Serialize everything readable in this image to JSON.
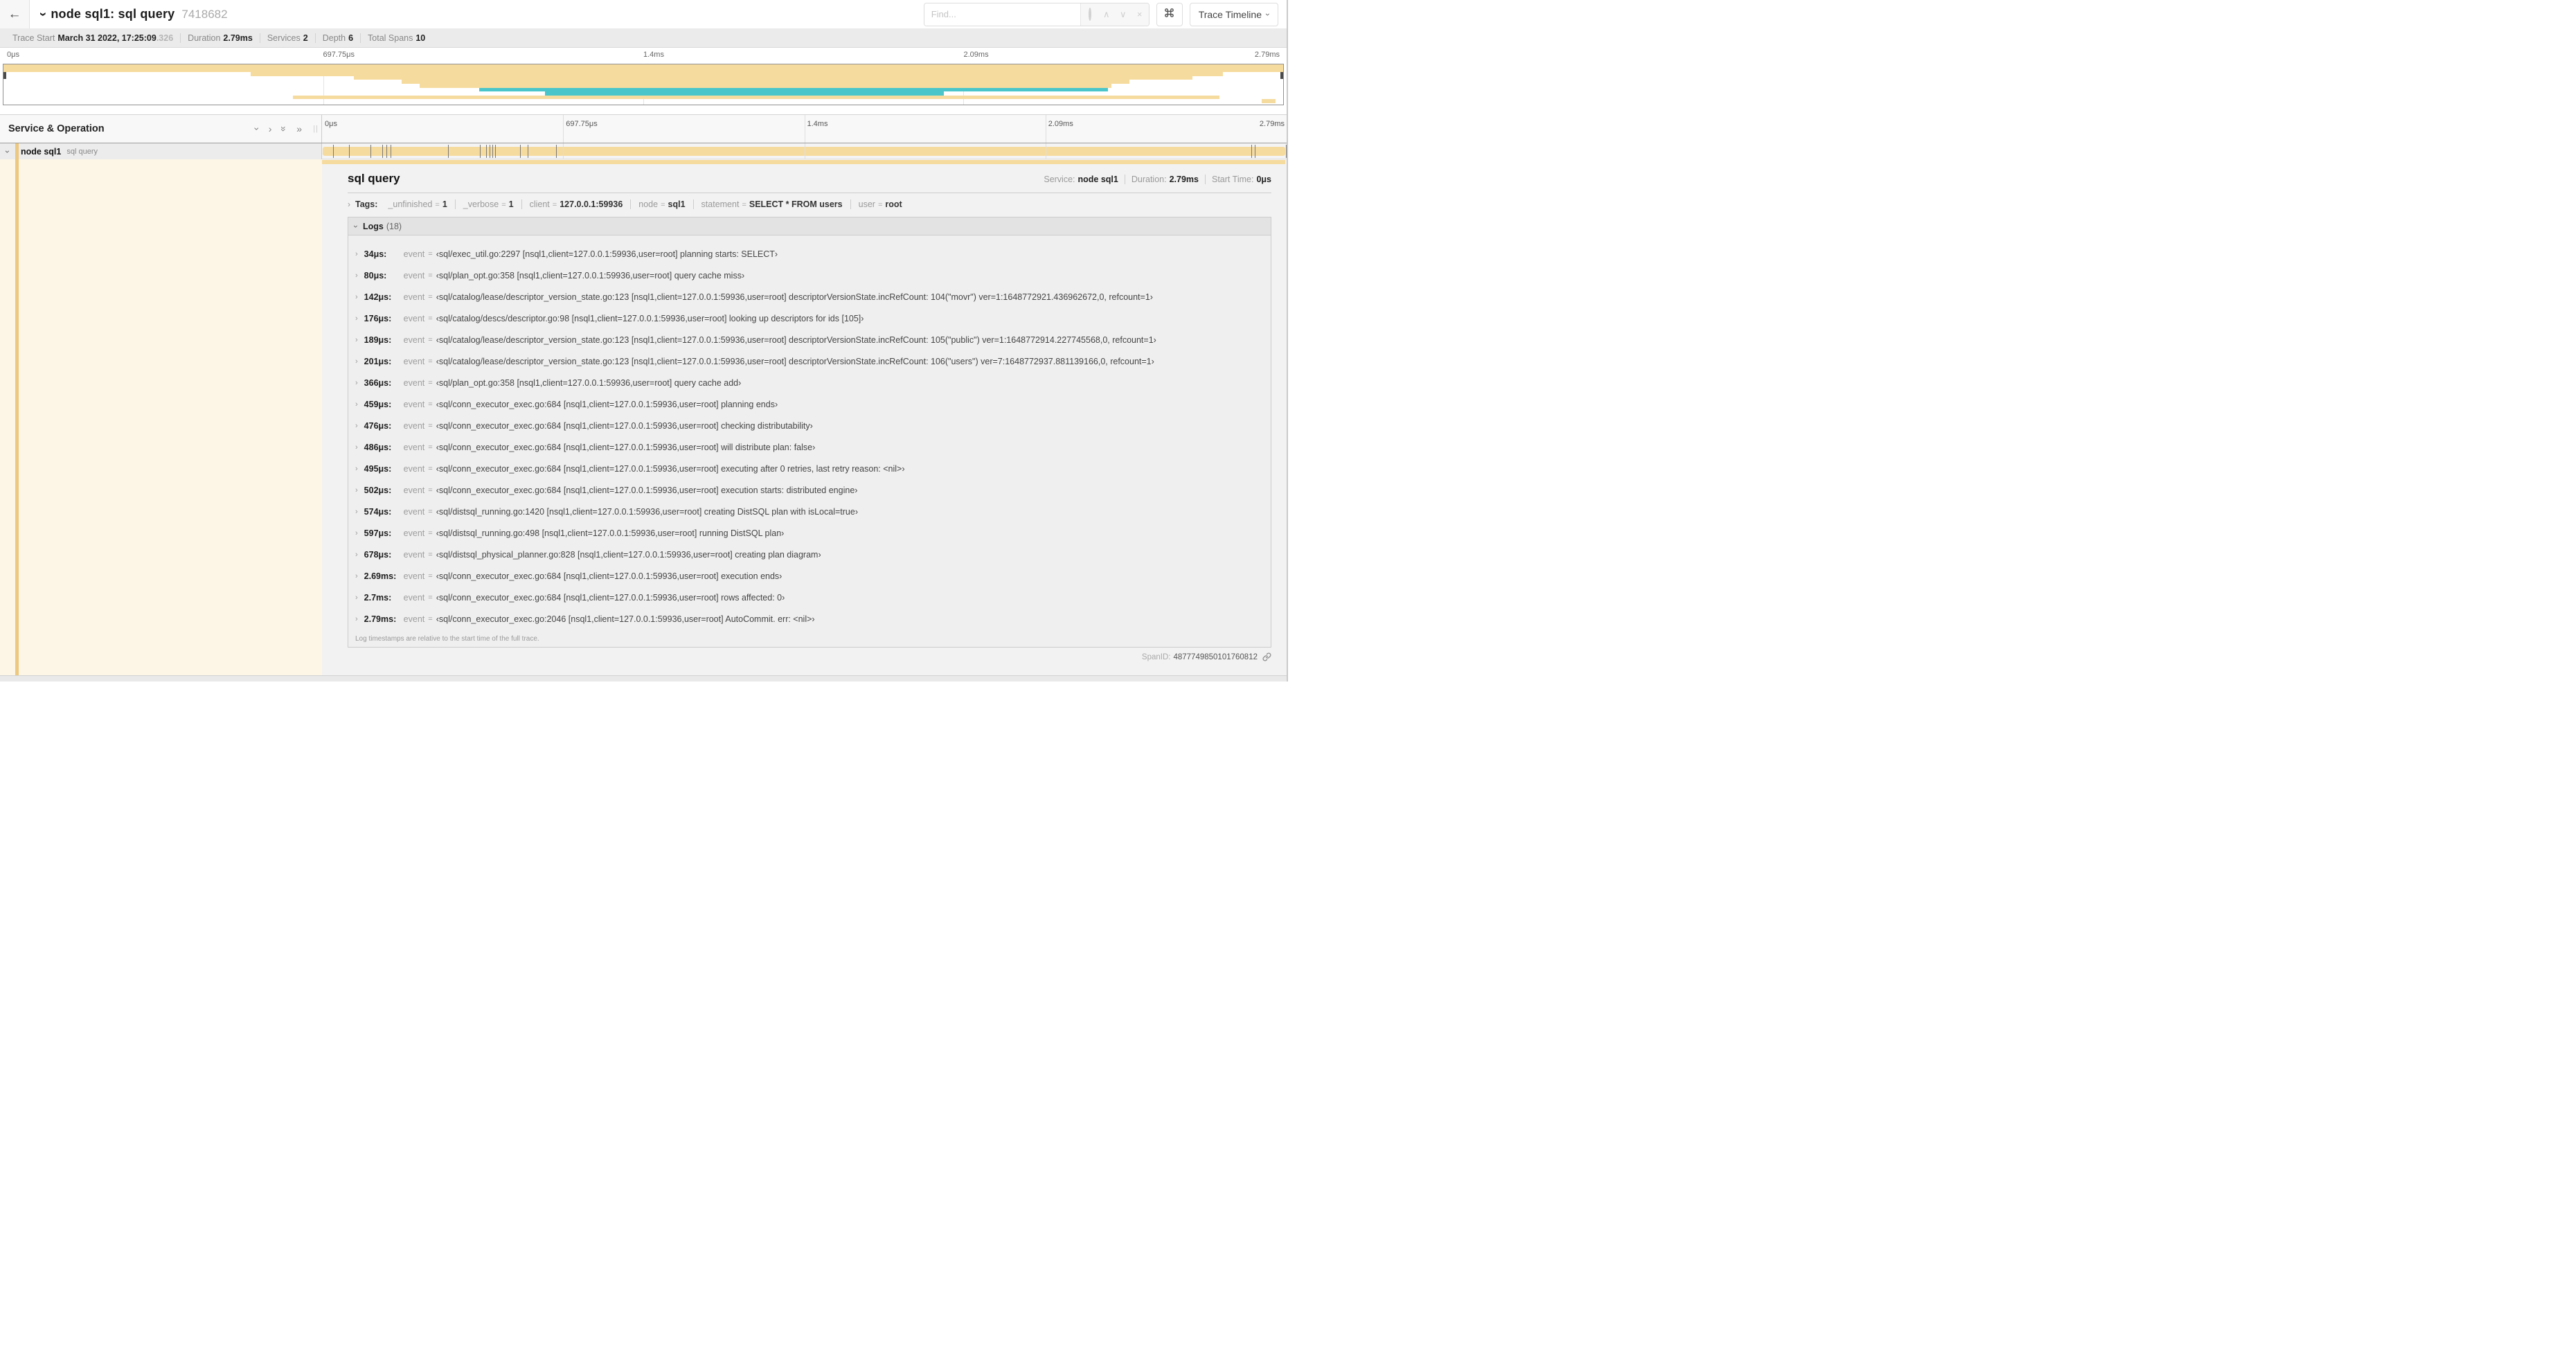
{
  "header": {
    "back_icon": "←",
    "title": "node sql1: sql query",
    "trace_id": "7418682",
    "find_placeholder": "Find...",
    "view_selector": "Trace Timeline"
  },
  "trace_bar": {
    "items": [
      {
        "label": "Trace Start",
        "value": "March 31 2022, 17:25:09",
        "suffix": ".326"
      },
      {
        "label": "Duration",
        "value": "2.79ms"
      },
      {
        "label": "Services",
        "value": "2"
      },
      {
        "label": "Depth",
        "value": "6"
      },
      {
        "label": "Total Spans",
        "value": "10"
      }
    ]
  },
  "minimap": {
    "time_labels": [
      {
        "text": "0μs",
        "pos": 0
      },
      {
        "text": "697.75μs",
        "pos": 25
      },
      {
        "text": "1.4ms",
        "pos": 50
      },
      {
        "text": "2.09ms",
        "pos": 75
      },
      {
        "text": "2.79ms",
        "pos": 100
      }
    ],
    "colors": {
      "tan": "#f6db9e",
      "teal": "#4ac6cb"
    },
    "bars": [
      {
        "row": 0,
        "rows": 2,
        "start": 0,
        "end": 100,
        "color": "tan"
      },
      {
        "row": 2,
        "rows": 1,
        "start": 19.3,
        "end": 95.3,
        "color": "tan"
      },
      {
        "row": 3,
        "rows": 1,
        "start": 27.4,
        "end": 92.9,
        "color": "tan"
      },
      {
        "row": 4,
        "rows": 1,
        "start": 31.1,
        "end": 88.0,
        "color": "tan"
      },
      {
        "row": 5,
        "rows": 1,
        "start": 32.5,
        "end": 86.6,
        "color": "tan"
      },
      {
        "row": 6,
        "rows": 1,
        "start": 37.2,
        "end": 86.3,
        "color": "teal"
      },
      {
        "row": 7,
        "rows": 1,
        "start": 42.3,
        "end": 73.5,
        "color": "teal"
      },
      {
        "row": 8,
        "rows": 1,
        "start": 22.6,
        "end": 95.0,
        "color": "tan"
      },
      {
        "row": 9,
        "rows": 1,
        "start": 98.3,
        "end": 99.4,
        "color": "tan"
      }
    ]
  },
  "timeline": {
    "panel_title": "Service & Operation",
    "icons": [
      {
        "name": "collapse-one-icon",
        "glyph": "›",
        "rotate": true
      },
      {
        "name": "expand-one-icon",
        "glyph": "›",
        "rotate": false
      },
      {
        "name": "collapse-all-icon",
        "glyph": "»",
        "rotate": true
      },
      {
        "name": "expand-all-icon",
        "glyph": "»",
        "rotate": false
      }
    ],
    "row": {
      "service": "node sql1",
      "operation": "sql query",
      "total_us": 2790,
      "log_times_us": [
        34,
        80,
        142,
        176,
        189,
        201,
        366,
        459,
        476,
        486,
        495,
        502,
        574,
        597,
        678,
        2690,
        2700,
        2790
      ]
    }
  },
  "detail": {
    "title": "sql query",
    "meta": [
      {
        "label": "Service:",
        "value": "node sql1"
      },
      {
        "label": "Duration:",
        "value": "2.79ms"
      },
      {
        "label": "Start Time:",
        "value": "0μs"
      }
    ],
    "tags": {
      "label": "Tags:",
      "eq": "=",
      "items": [
        {
          "key": "_unfinished",
          "value": "1"
        },
        {
          "key": "_verbose",
          "value": "1"
        },
        {
          "key": "client",
          "value": "127.0.0.1:59936"
        },
        {
          "key": "node",
          "value": "sql1"
        },
        {
          "key": "statement",
          "value": "SELECT * FROM users"
        },
        {
          "key": "user",
          "value": "root"
        }
      ]
    },
    "logs": {
      "label": "Logs",
      "count": "(18)",
      "key": "event",
      "eq": "=",
      "rows": [
        {
          "time": "34μs:",
          "value": "‹sql/exec_util.go:2297 [nsql1,client=127.0.0.1:59936,user=root] planning starts: SELECT›"
        },
        {
          "time": "80μs:",
          "value": "‹sql/plan_opt.go:358 [nsql1,client=127.0.0.1:59936,user=root] query cache miss›"
        },
        {
          "time": "142μs:",
          "value": "‹sql/catalog/lease/descriptor_version_state.go:123 [nsql1,client=127.0.0.1:59936,user=root] descriptorVersionState.incRefCount: 104(\"movr\") ver=1:1648772921.436962672,0, refcount=1›"
        },
        {
          "time": "176μs:",
          "value": "‹sql/catalog/descs/descriptor.go:98 [nsql1,client=127.0.0.1:59936,user=root] looking up descriptors for ids [105]›"
        },
        {
          "time": "189μs:",
          "value": "‹sql/catalog/lease/descriptor_version_state.go:123 [nsql1,client=127.0.0.1:59936,user=root] descriptorVersionState.incRefCount: 105(\"public\") ver=1:1648772914.227745568,0, refcount=1›"
        },
        {
          "time": "201μs:",
          "value": "‹sql/catalog/lease/descriptor_version_state.go:123 [nsql1,client=127.0.0.1:59936,user=root] descriptorVersionState.incRefCount: 106(\"users\") ver=7:1648772937.881139166,0, refcount=1›"
        },
        {
          "time": "366μs:",
          "value": "‹sql/plan_opt.go:358 [nsql1,client=127.0.0.1:59936,user=root] query cache add›"
        },
        {
          "time": "459μs:",
          "value": "‹sql/conn_executor_exec.go:684 [nsql1,client=127.0.0.1:59936,user=root] planning ends›"
        },
        {
          "time": "476μs:",
          "value": "‹sql/conn_executor_exec.go:684 [nsql1,client=127.0.0.1:59936,user=root] checking distributability›"
        },
        {
          "time": "486μs:",
          "value": "‹sql/conn_executor_exec.go:684 [nsql1,client=127.0.0.1:59936,user=root] will distribute plan: false›"
        },
        {
          "time": "495μs:",
          "value": "‹sql/conn_executor_exec.go:684 [nsql1,client=127.0.0.1:59936,user=root] executing after 0 retries, last retry reason: <nil>›"
        },
        {
          "time": "502μs:",
          "value": "‹sql/conn_executor_exec.go:684 [nsql1,client=127.0.0.1:59936,user=root] execution starts: distributed engine›"
        },
        {
          "time": "574μs:",
          "value": "‹sql/distsql_running.go:1420 [nsql1,client=127.0.0.1:59936,user=root] creating DistSQL plan with isLocal=true›"
        },
        {
          "time": "597μs:",
          "value": "‹sql/distsql_running.go:498 [nsql1,client=127.0.0.1:59936,user=root] running DistSQL plan›"
        },
        {
          "time": "678μs:",
          "value": "‹sql/distsql_physical_planner.go:828 [nsql1,client=127.0.0.1:59936,user=root] creating plan diagram›"
        },
        {
          "time": "2.69ms:",
          "value": "‹sql/conn_executor_exec.go:684 [nsql1,client=127.0.0.1:59936,user=root] execution ends›"
        },
        {
          "time": "2.7ms:",
          "value": "‹sql/conn_executor_exec.go:684 [nsql1,client=127.0.0.1:59936,user=root] rows affected: 0›"
        },
        {
          "time": "2.79ms:",
          "value": "‹sql/conn_executor_exec.go:2046 [nsql1,client=127.0.0.1:59936,user=root] AutoCommit. err: <nil>›"
        }
      ]
    },
    "footer_note": "Log timestamps are relative to the start time of the full trace.",
    "span_id_label": "SpanID:",
    "span_id": "4877749850101760812"
  }
}
